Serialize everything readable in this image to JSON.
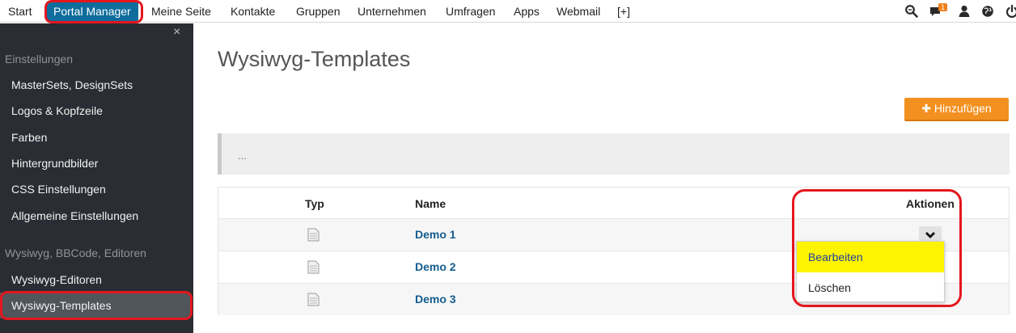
{
  "topbar": {
    "items": [
      "Start",
      "Portal Manager",
      "Meine Seite",
      "Kontakte",
      "Gruppen",
      "Unternehmen",
      "Umfragen",
      "Apps",
      "Webmail",
      "[+]"
    ],
    "notification_count": "1",
    "icons": [
      "search-icon",
      "chat-icon",
      "user-icon",
      "globe-icon",
      "power-icon"
    ]
  },
  "sidebar": {
    "close": "×",
    "section1": "Einstellungen",
    "items1": [
      "MasterSets, DesignSets",
      "Logos & Kopfzeile",
      "Farben",
      "Hintergrundbilder",
      "CSS Einstellungen",
      "Allgemeine Einstellungen"
    ],
    "section2": "Wysiwyg, BBCode, Editoren",
    "items2": [
      "Wysiwyg-Editoren",
      "Wysiwyg-Templates"
    ]
  },
  "main": {
    "title": "Wysiwyg-Templates",
    "add_button": "Hinzufügen",
    "info_text": "...",
    "table": {
      "headers": [
        "Typ",
        "Name",
        "Aktionen"
      ],
      "rows": [
        "Demo 1",
        "Demo 2",
        "Demo 3"
      ]
    },
    "dropdown": [
      "Bearbeiten",
      "Löschen"
    ]
  },
  "colors": {
    "accent": "#0e6d9c",
    "sidebar_bg": "#2a2d33",
    "add_button": "#f39120",
    "highlight": "#fff400",
    "annotation_ring": "#e4161d"
  }
}
